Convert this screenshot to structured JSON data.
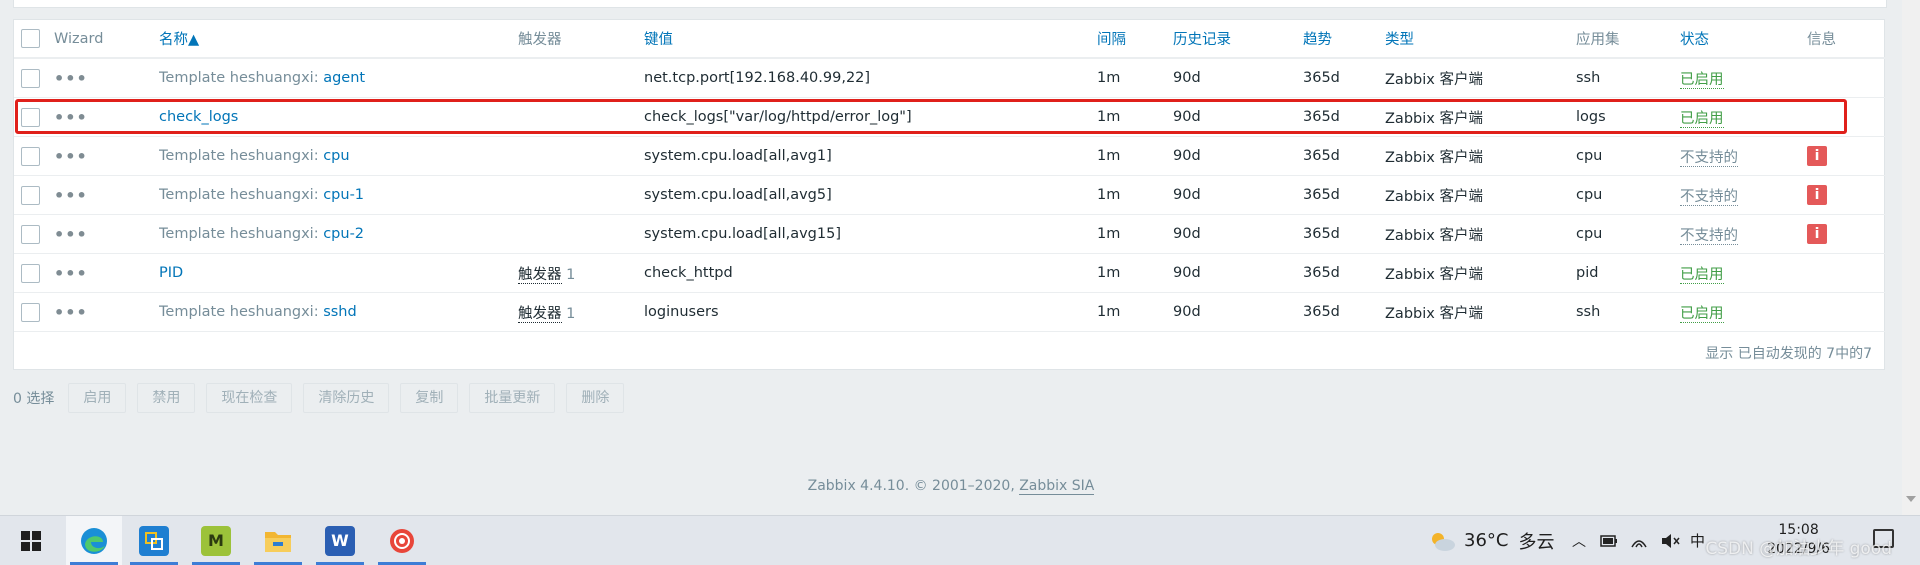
{
  "table": {
    "headers": {
      "wizard": "Wizard",
      "name": "名称▲",
      "triggers": "触发器",
      "key": "键值",
      "interval": "间隔",
      "history": "历史记录",
      "trends": "趋势",
      "type": "类型",
      "applications": "应用集",
      "status": "状态",
      "info": "信息"
    },
    "rows": [
      {
        "prefix": "Template heshuangxi: ",
        "name": "agent",
        "triggers_label": "",
        "triggers_count": "",
        "key": "net.tcp.port[192.168.40.99,22]",
        "interval": "1m",
        "history": "90d",
        "trends": "365d",
        "type": "Zabbix 客户端",
        "application": "ssh",
        "status": "已启用",
        "info": ""
      },
      {
        "prefix": "",
        "name": "check_logs",
        "triggers_label": "",
        "triggers_count": "",
        "key": "check_logs[\"var/log/httpd/error_log\"]",
        "interval": "1m",
        "history": "90d",
        "trends": "365d",
        "type": "Zabbix 客户端",
        "application": "logs",
        "status": "已启用",
        "info": ""
      },
      {
        "prefix": "Template heshuangxi: ",
        "name": "cpu",
        "triggers_label": "",
        "triggers_count": "",
        "key": "system.cpu.load[all,avg1]",
        "interval": "1m",
        "history": "90d",
        "trends": "365d",
        "type": "Zabbix 客户端",
        "application": "cpu",
        "status": "不支持的",
        "info": "i"
      },
      {
        "prefix": "Template heshuangxi: ",
        "name": "cpu-1",
        "triggers_label": "",
        "triggers_count": "",
        "key": "system.cpu.load[all,avg5]",
        "interval": "1m",
        "history": "90d",
        "trends": "365d",
        "type": "Zabbix 客户端",
        "application": "cpu",
        "status": "不支持的",
        "info": "i"
      },
      {
        "prefix": "Template heshuangxi: ",
        "name": "cpu-2",
        "triggers_label": "",
        "triggers_count": "",
        "key": "system.cpu.load[all,avg15]",
        "interval": "1m",
        "history": "90d",
        "trends": "365d",
        "type": "Zabbix 客户端",
        "application": "cpu",
        "status": "不支持的",
        "info": "i"
      },
      {
        "prefix": "",
        "name": "PID",
        "triggers_label": "触发器",
        "triggers_count": "1",
        "key": "check_httpd",
        "interval": "1m",
        "history": "90d",
        "trends": "365d",
        "type": "Zabbix 客户端",
        "application": "pid",
        "status": "已启用",
        "info": ""
      },
      {
        "prefix": "Template heshuangxi: ",
        "name": "sshd",
        "triggers_label": "触发器",
        "triggers_count": "1",
        "key": "loginusers",
        "interval": "1m",
        "history": "90d",
        "trends": "365d",
        "type": "Zabbix 客户端",
        "application": "ssh",
        "status": "已启用",
        "info": ""
      }
    ],
    "dots": "•••",
    "footer": "显示 已自动发现的 7中的7"
  },
  "actions": {
    "selected": "0 选择",
    "buttons": [
      "启用",
      "禁用",
      "现在检查",
      "清除历史",
      "复制",
      "批量更新",
      "删除"
    ]
  },
  "footer": {
    "text": "Zabbix 4.4.10. © 2001–2020, ",
    "link": "Zabbix SIA"
  },
  "taskbar": {
    "apps": [
      {
        "icon": "windows-start-icon",
        "active": false
      },
      {
        "icon": "edge-browser-icon",
        "active": true
      },
      {
        "icon": "network-app-icon",
        "active": true,
        "letter": ""
      },
      {
        "icon": "m-app-icon",
        "active": true,
        "letter": "M"
      },
      {
        "icon": "file-explorer-icon",
        "active": true
      },
      {
        "icon": "word-icon",
        "active": true,
        "letter": "W"
      },
      {
        "icon": "snail-app-icon",
        "active": true
      }
    ],
    "weather_temp": "36°C",
    "weather_desc": "多云",
    "time": "15:08",
    "date": "2022/9/6",
    "watermark": "CSDN @加油少年 good"
  },
  "colors": {
    "link": "#0275b8",
    "enabled": "#429e47",
    "unsupported": "#768d99",
    "error": "#e45959",
    "highlight": "#e0201b"
  }
}
